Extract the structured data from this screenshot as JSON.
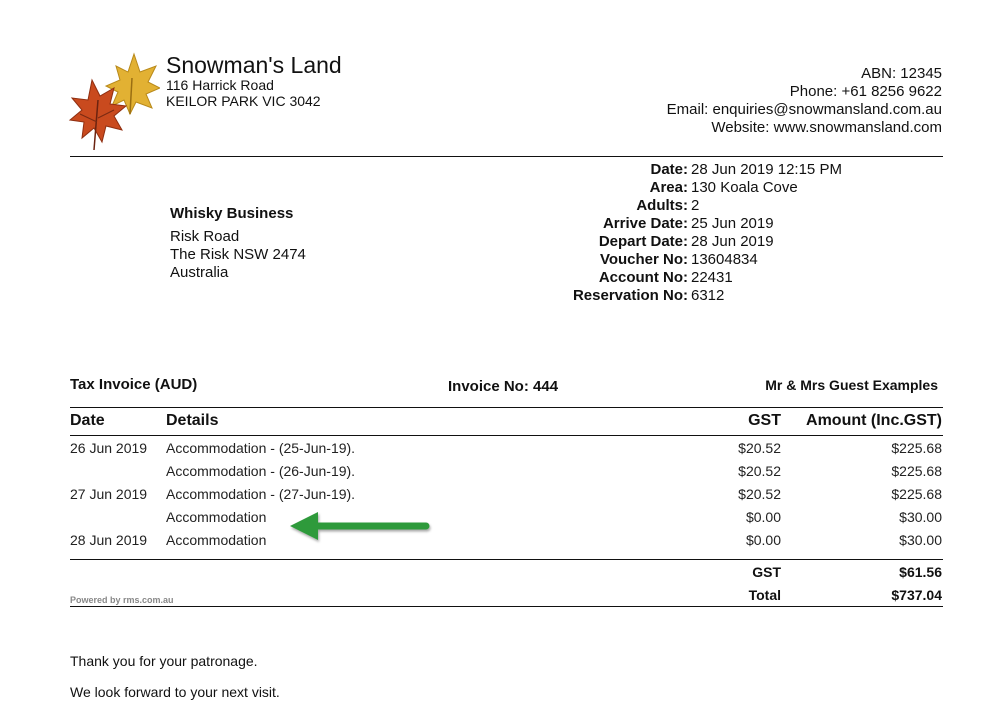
{
  "company": {
    "name": "Snowman's Land",
    "address_line1": "116 Harrick Road",
    "address_line2": "KEILOR PARK VIC 3042",
    "abn": "ABN: 12345",
    "phone": "Phone: +61 8256 9622",
    "email": "Email: enquiries@snowmansland.com.au",
    "website": "Website: www.snowmansland.com"
  },
  "customer": {
    "name": "Whisky Business",
    "line1": "Risk Road",
    "line2": "The Risk NSW 2474",
    "line3": "Australia"
  },
  "details": [
    {
      "label": "Date:",
      "value": "28 Jun 2019 12:15 PM"
    },
    {
      "label": "Area:",
      "value": "130 Koala Cove"
    },
    {
      "label": "Adults:",
      "value": "2"
    },
    {
      "label": "Arrive Date:",
      "value": "25 Jun 2019"
    },
    {
      "label": "Depart Date:",
      "value": "28 Jun 2019"
    },
    {
      "label": "Voucher No:",
      "value": "13604834"
    },
    {
      "label": "Account No:",
      "value": "22431"
    },
    {
      "label": "Reservation No:",
      "value": "6312"
    }
  ],
  "invoice": {
    "title": "Tax Invoice (AUD)",
    "number": "Invoice No: 444",
    "guest": "Mr & Mrs Guest Examples"
  },
  "table": {
    "headers": {
      "date": "Date",
      "details": "Details",
      "gst": "GST",
      "amount": "Amount (Inc.GST)"
    },
    "rows": [
      {
        "date": "26 Jun 2019",
        "details": "Accommodation - (25-Jun-19).",
        "gst": "$20.52",
        "amount": "$225.68"
      },
      {
        "date": "",
        "details": "Accommodation - (26-Jun-19).",
        "gst": "$20.52",
        "amount": "$225.68"
      },
      {
        "date": "27 Jun 2019",
        "details": "Accommodation - (27-Jun-19).",
        "gst": "$20.52",
        "amount": "$225.68"
      },
      {
        "date": "",
        "details": "Accommodation",
        "gst": "$0.00",
        "amount": "$30.00"
      },
      {
        "date": "28 Jun 2019",
        "details": "Accommodation",
        "gst": "$0.00",
        "amount": "$30.00"
      }
    ]
  },
  "totals": {
    "gst_label": "GST",
    "gst_value": "$61.56",
    "total_label": "Total",
    "total_value": "$737.04"
  },
  "powered_by": "Powered by rms.com.au",
  "footer": {
    "thanks": "Thank you for your patronage.",
    "visit": "We look forward to your next visit."
  },
  "colors": {
    "arrow": "#2e9a3a",
    "leaf_red": "#c94a1e",
    "leaf_gold": "#e2b133"
  },
  "icons": {
    "logo": "autumn-leaves-logo",
    "annotation": "left-arrow-icon"
  }
}
